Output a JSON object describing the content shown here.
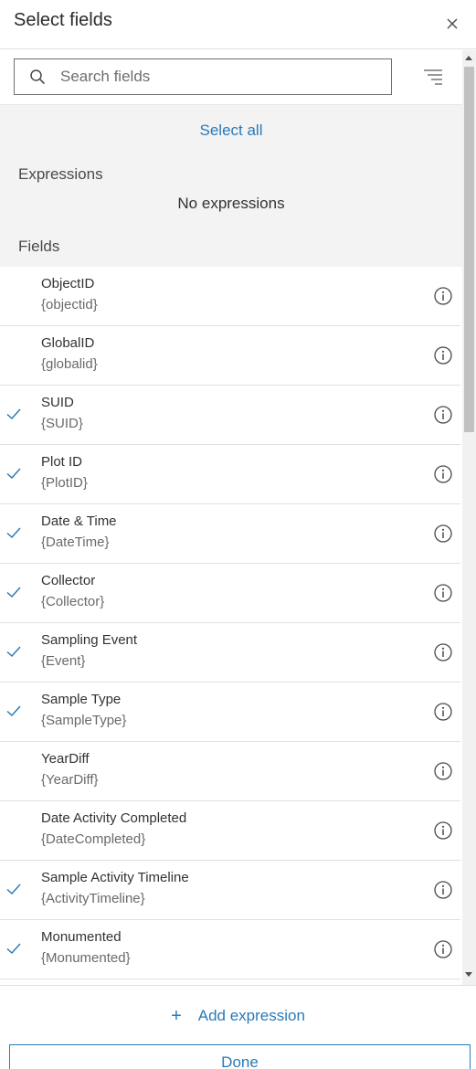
{
  "header": {
    "title": "Select fields",
    "close_icon": "close-icon"
  },
  "search": {
    "placeholder": "Search fields",
    "value": "",
    "icon": "search-icon",
    "filter_icon": "filter-lines-icon"
  },
  "select_all_label": "Select all",
  "expressions": {
    "label": "Expressions",
    "empty_text": "No expressions"
  },
  "fields_label": "Fields",
  "fields": [
    {
      "name": "ObjectID",
      "key": "{objectid}",
      "checked": false
    },
    {
      "name": "GlobalID",
      "key": "{globalid}",
      "checked": false
    },
    {
      "name": "SUID",
      "key": "{SUID}",
      "checked": true
    },
    {
      "name": "Plot ID",
      "key": "{PlotID}",
      "checked": true
    },
    {
      "name": "Date & Time",
      "key": "{DateTime}",
      "checked": true
    },
    {
      "name": "Collector",
      "key": "{Collector}",
      "checked": true
    },
    {
      "name": "Sampling Event",
      "key": "{Event}",
      "checked": true
    },
    {
      "name": "Sample Type",
      "key": "{SampleType}",
      "checked": true
    },
    {
      "name": "YearDiff",
      "key": "{YearDiff}",
      "checked": false
    },
    {
      "name": "Date Activity Completed",
      "key": "{DateCompleted}",
      "checked": false
    },
    {
      "name": "Sample Activity Timeline",
      "key": "{ActivityTimeline}",
      "checked": true
    },
    {
      "name": "Monumented",
      "key": "{Monumented}",
      "checked": true
    }
  ],
  "footer": {
    "add_expression_label": "Add expression",
    "done_label": "Done"
  },
  "colors": {
    "accent": "#2a7ab8",
    "check": "#2a7ab8",
    "section_bg": "#f3f3f3"
  }
}
